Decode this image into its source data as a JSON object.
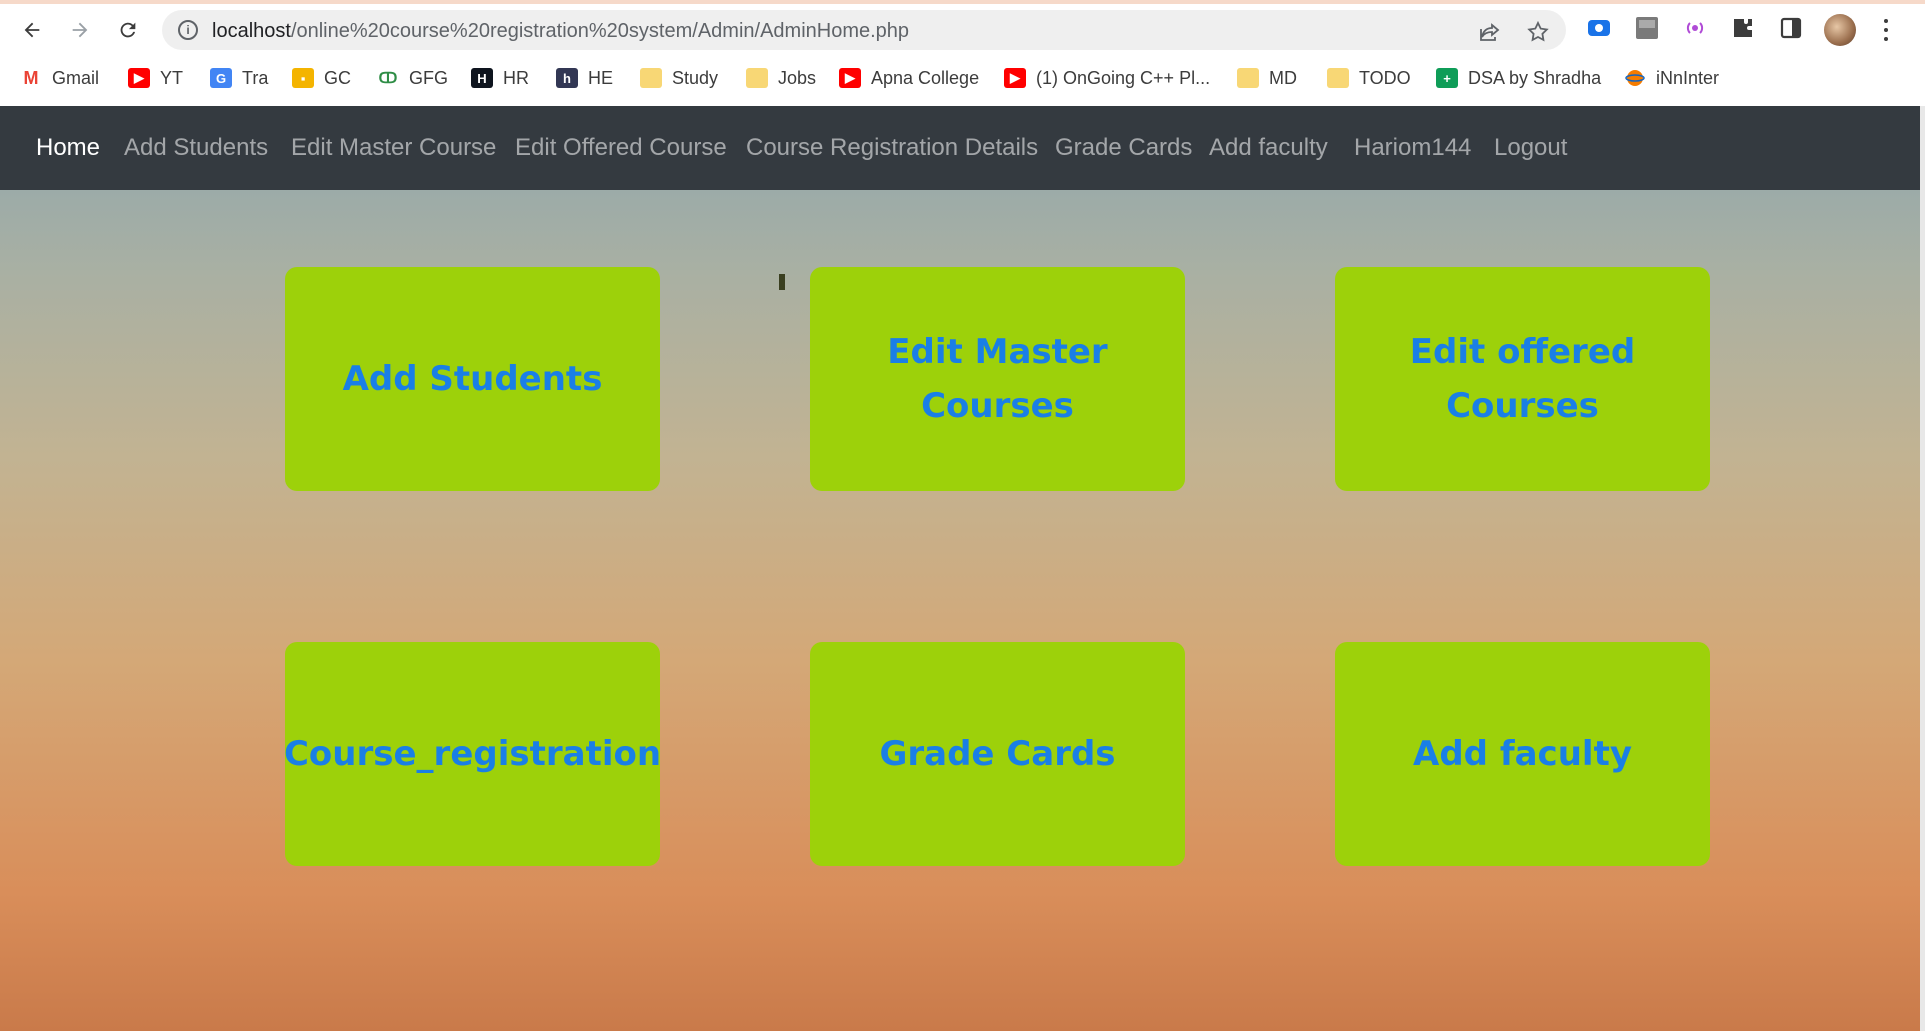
{
  "browser": {
    "url_host": "localhost",
    "url_path": "/online%20course%20registration%20system/Admin/AdminHome.php",
    "bookmarks": [
      {
        "label": "Gmail",
        "icon": "gmail-icon",
        "color": "#ea4335"
      },
      {
        "label": "YT",
        "icon": "youtube-icon",
        "color": "#ff0000"
      },
      {
        "label": "Tra",
        "icon": "translate-icon",
        "color": "#4285f4"
      },
      {
        "label": "GC",
        "icon": "classroom-icon",
        "color": "#f4b400"
      },
      {
        "label": "GFG",
        "icon": "gfg-icon",
        "color": "#2f8d46"
      },
      {
        "label": "HR",
        "icon": "hackerrank-icon",
        "color": "#0e141e"
      },
      {
        "label": "HE",
        "icon": "hackerearth-icon",
        "color": "#323754"
      },
      {
        "label": "Study",
        "icon": "folder-icon",
        "color": "#f8d775"
      },
      {
        "label": "Jobs",
        "icon": "folder-icon",
        "color": "#f8d775"
      },
      {
        "label": "Apna College",
        "icon": "youtube-icon",
        "color": "#ff0000"
      },
      {
        "label": "(1) OnGoing C++ Pl...",
        "icon": "youtube-icon",
        "color": "#ff0000"
      },
      {
        "label": "MD",
        "icon": "folder-icon",
        "color": "#f8d775"
      },
      {
        "label": "TODO",
        "icon": "folder-icon",
        "color": "#f8d775"
      },
      {
        "label": "DSA by Shradha",
        "icon": "sheets-icon",
        "color": "#0f9d58"
      },
      {
        "label": "iNnInter",
        "icon": "innointer-icon",
        "color": "#f57c00"
      }
    ]
  },
  "navbar": {
    "items": [
      {
        "label": "Home",
        "active": true
      },
      {
        "label": "Add Students",
        "active": false
      },
      {
        "label": "Edit Master Course",
        "active": false
      },
      {
        "label": "Edit Offered Course",
        "active": false
      },
      {
        "label": "Course Registration Details",
        "active": false
      },
      {
        "label": "Grade Cards",
        "active": false
      },
      {
        "label": "Add faculty",
        "active": false
      },
      {
        "label": "Hariom144",
        "active": false
      },
      {
        "label": "Logout",
        "active": false
      }
    ]
  },
  "cards": [
    {
      "label": "Add Students"
    },
    {
      "label": "Edit Master Courses"
    },
    {
      "label": "Edit offered Courses"
    },
    {
      "label": "Course_registration"
    },
    {
      "label": "Grade Cards"
    },
    {
      "label": "Add faculty"
    }
  ],
  "colors": {
    "navbar_bg": "#343a40",
    "card_bg": "#9dd10a",
    "card_text": "#1a7fe6"
  }
}
